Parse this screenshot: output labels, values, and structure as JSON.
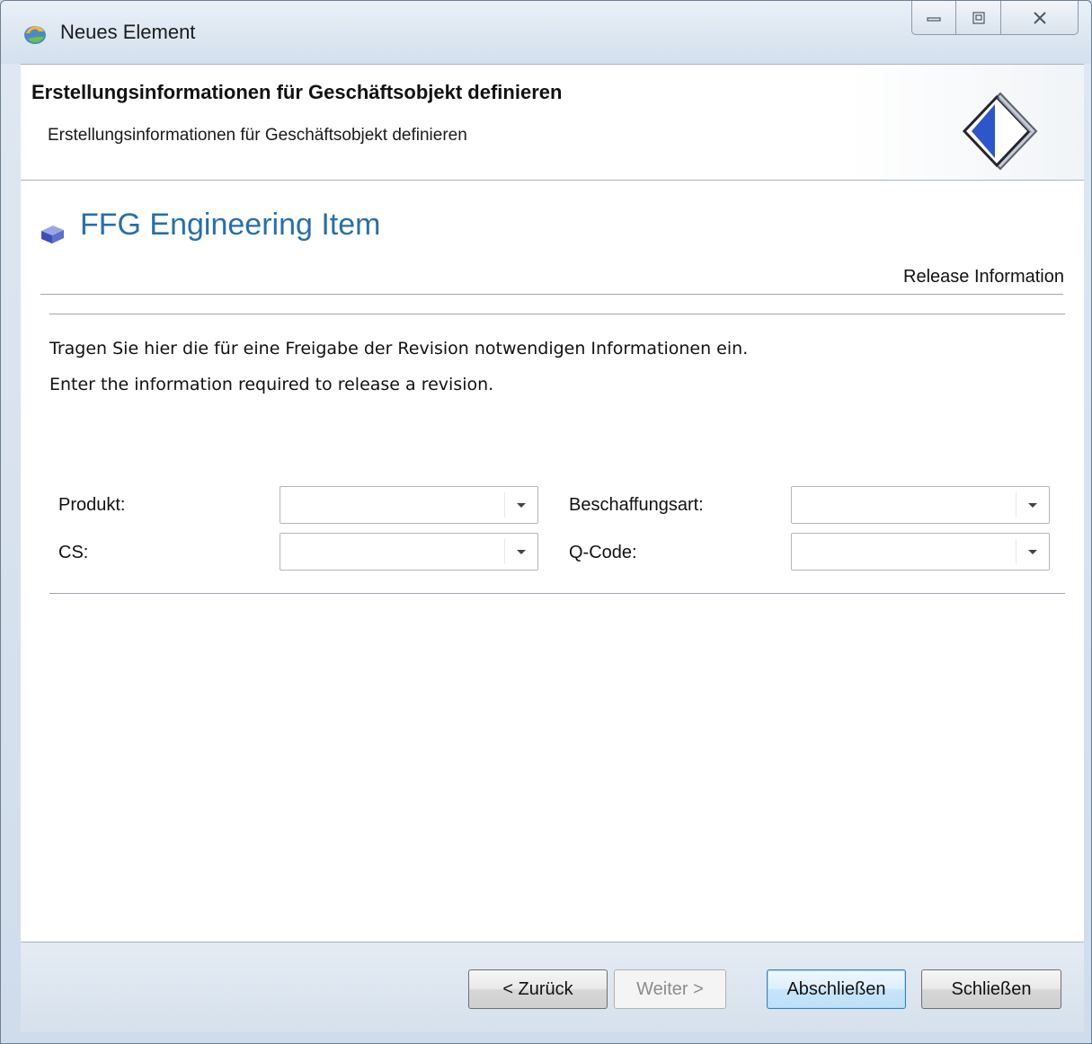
{
  "window": {
    "title": "Neues Element",
    "controls": {
      "minimize_icon": "minimize-icon",
      "maximize_icon": "maximize-icon",
      "close_icon": "close-icon"
    }
  },
  "header": {
    "title": "Erstellungsinformationen für Geschäftsobjekt definieren",
    "subtitle": "Erstellungsinformationen für Geschäftsobjekt definieren",
    "icon": "wizard-diamond-icon"
  },
  "content": {
    "object_title": "FFG Engineering Item",
    "object_icon": "cube-icon",
    "section_label": "Release Information",
    "description_de": "Tragen Sie hier die für eine Freigabe der Revision notwendigen Informationen ein.",
    "description_en": "Enter the information required to release a revision.",
    "fields": [
      {
        "label": "Produkt:",
        "value": ""
      },
      {
        "label": "Beschaffungsart:",
        "value": ""
      },
      {
        "label": "CS:",
        "value": ""
      },
      {
        "label": "Q-Code:",
        "value": ""
      }
    ]
  },
  "footer": {
    "back_label": "< Zurück",
    "next_label": "Weiter >",
    "finish_label": "Abschließen",
    "close_label": "Schließen"
  },
  "colors": {
    "accent_title": "#2a6fa6",
    "default_button_border": "#3c7fb1"
  }
}
